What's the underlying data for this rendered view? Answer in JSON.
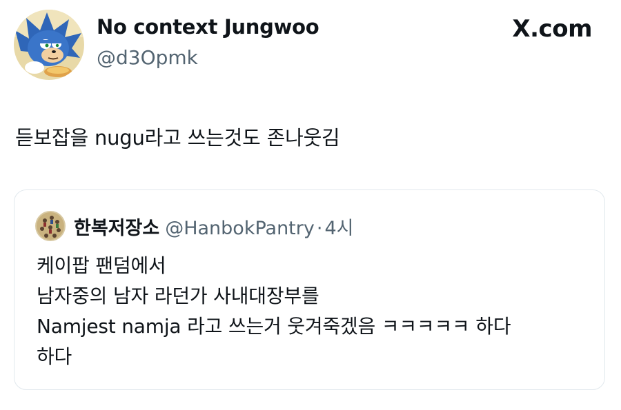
{
  "author": {
    "display_name": "No context Jungwoo",
    "handle": "@d3Opmk"
  },
  "brand": "X.com",
  "tweet_text": "듣보잡을  nugu라고 쓰는것도 존나웃김",
  "quote": {
    "author_name": "한복저장소",
    "author_handle": "@HanbokPantry",
    "separator": "·",
    "time": "4시",
    "lines": [
      "케이팝 팬덤에서",
      "남자중의 남자 라던가 사내대장부를",
      "Namjest namja 라고 쓰는거 웃겨죽겠음 ㅋㅋㅋㅋㅋ 하다",
      "하다"
    ]
  },
  "colors": {
    "text": "#0f1419",
    "secondary": "#536471",
    "border": "#e1e8ed",
    "background": "#ffffff"
  },
  "icons": {
    "avatar": "cartoon-hedgehog-avatar",
    "quote_avatar": "hanbok-figures-avatar"
  }
}
